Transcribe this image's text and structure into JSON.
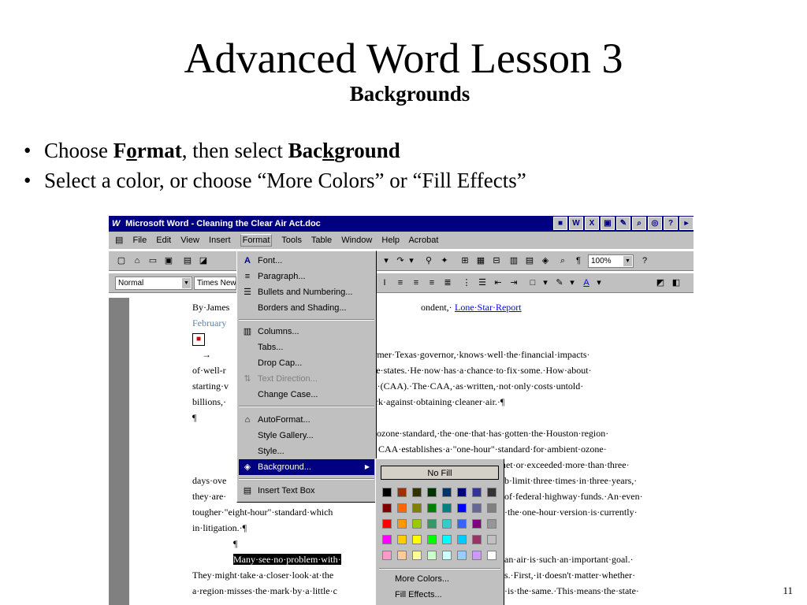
{
  "slide": {
    "title": "Advanced Word Lesson 3",
    "subtitle": "Backgrounds",
    "bullet1_a": "Choose ",
    "bullet1_b": "F",
    "bullet1_c": "o",
    "bullet1_d": "rmat",
    "bullet1_e": ", then select ",
    "bullet1_f": "Bac",
    "bullet1_g": "k",
    "bullet1_h": "ground",
    "bullet2": "Select a color, or choose “More Colors” or “Fill Effects”",
    "page_number": "11"
  },
  "window": {
    "title": "Microsoft Word - Cleaning the Clear Air Act.doc",
    "menus": [
      "File",
      "Edit",
      "View",
      "Insert",
      "Format",
      "Tools",
      "Table",
      "Window",
      "Help",
      "Acrobat"
    ],
    "style_value": "Normal",
    "font_value": "Times New Roman",
    "zoom_value": "100%"
  },
  "format_menu": {
    "items": [
      "Font...",
      "Paragraph...",
      "Bullets and Numbering...",
      "Borders and Shading...",
      "Columns...",
      "Tabs...",
      "Drop Cap...",
      "Text Direction...",
      "Change Case...",
      "AutoFormat...",
      "Style Gallery...",
      "Style...",
      "Background...",
      "Insert Text Box"
    ]
  },
  "color_popup": {
    "no_fill": "No Fill",
    "more_colors": "More Colors...",
    "fill_effects": "Fill Effects...",
    "colors": [
      [
        "#000000",
        "#993300",
        "#333300",
        "#003300",
        "#003366",
        "#000080",
        "#333399",
        "#333333"
      ],
      [
        "#800000",
        "#ff6600",
        "#808000",
        "#008000",
        "#008080",
        "#0000ff",
        "#666699",
        "#808080"
      ],
      [
        "#ff0000",
        "#ff9900",
        "#99cc00",
        "#339966",
        "#33cccc",
        "#3366ff",
        "#800080",
        "#969696"
      ],
      [
        "#ff00ff",
        "#ffcc00",
        "#ffff00",
        "#00ff00",
        "#00ffff",
        "#00ccff",
        "#993366",
        "#c0c0c0"
      ],
      [
        "#ff99cc",
        "#ffcc99",
        "#ffff99",
        "#ccffcc",
        "#ccffff",
        "#99ccff",
        "#cc99ff",
        "#ffffff"
      ]
    ]
  },
  "document": {
    "lines": [
      "By·James",
      "February",
      "",
      "",
      "of·well-r",
      "starting·v",
      "billions,·",
      "¶",
      "",
      "",
      "",
      "days·ove",
      "they·are·",
      "tougher·\"eight-hour\"·standard·which",
      "in·litigation.·¶",
      "¶",
      "Many·see·no·problem·with·",
      "They·might·take·a·closer·look·at·the",
      "a·region·misses·the·mark·by·a·little·c",
      ""
    ],
    "right_lines": [
      "ondent,·",
      "",
      "",
      "a·former·Texas·governor,·knows·well·the·financial·impacts·",
      "·the·states.·He·now·has·a·chance·to·fix·some.·How·about·",
      "ct·(CAA).·The·CAA,·as·written,·not·only·costs·untold·",
      "ork·against·obtaining·cleaner·air.·¶",
      "",
      "·ozone·standard,·the·one·that·has·gotten·the·Houston·region·",
      "CAA·establishes·a·\"one-hour\"·standard·for·ambient·ozone·",
      "net·or·exceeded·more·than·three·",
      "b·limit·three·times·in·three·years,·",
      "of·federal·highway·funds.·An·even·",
      "·the·one-hour·version·is·currently·",
      "",
      "",
      "an·air·is·such·an·important·goal.·",
      "s.·First,·it·doesn't·matter·whether·",
      "·is·the·same.·This·means·the·state·",
      ""
    ],
    "link_text": "Lone·Star·Report",
    "tab_arrow": "→"
  }
}
